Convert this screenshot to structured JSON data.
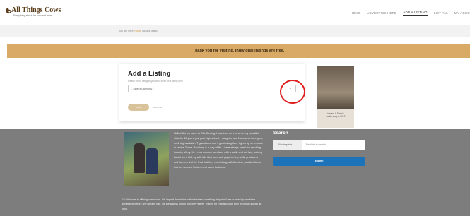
{
  "header": {
    "logo_text": "All Things Cows",
    "tagline": "Everything about the cow and more",
    "nav": [
      "HOME",
      "ADVERTISE HERE",
      "ADD A LISTING",
      "LIST ALL",
      "MY ACCO"
    ]
  },
  "breadcrumb": {
    "prefix": "You are here:",
    "home": "Home",
    "separator": "/",
    "current": "Add a listing"
  },
  "notice": "Thank you for visiting. Individual listings are free.",
  "form": {
    "title": "Add a Listing",
    "hint": "Please select category you want to list for a listing form",
    "select_placeholder": "- Select Category -",
    "add_button": "next",
    "cancel_link": "start over"
  },
  "ad": {
    "caption_line1": "Instant & Simple",
    "caption_line2": "easily shop & 2019"
  },
  "about_text": "Hello folks my name is Rita Sterling. I was born on a ranch in my beautiful state for 10 years, just past high school. I daughter and 1 son who have gone on 4 of grandkids – 7 grandsons and 4 great-daughters. I grew up on a ranch in central Texas. Ranching is a way of life. I have always loved the ranching industry all my life. I now own my own farm with a cattle and sell hay, looking back I am a little up with this idea for a web page to help cattle producers and farmers find the feed that they need along with the other possible items that are needed for farm and ranch business.",
  "welcome_text": "Go Welcome to allthingscows.com. We hope it then helps with advertise something they don't use or need up providers advertising before any already had, we are always on our own they travel. Thanks for Rita and Mike they their own stories at hand.",
  "search": {
    "title": "Search",
    "category_label": "All categories",
    "input_placeholder": "Find this to search",
    "submit_label": "submit"
  },
  "colors": {
    "notice_bg": "#d9aa66",
    "footer_bg": "#7d7d7d",
    "submit_bg": "#1c73b9",
    "highlight": "#e02020"
  }
}
